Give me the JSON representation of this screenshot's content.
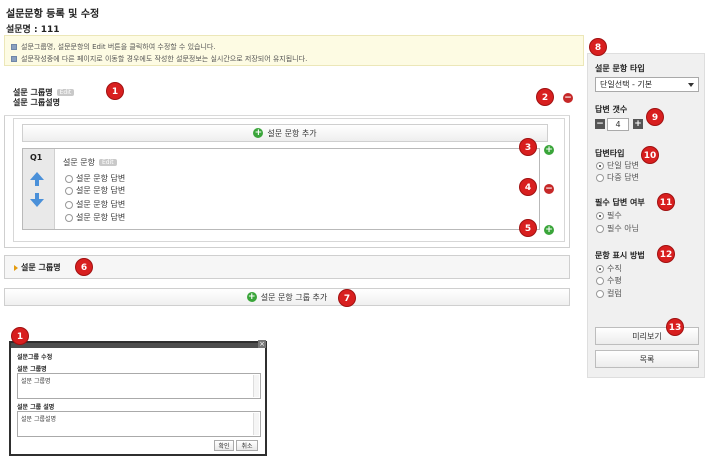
{
  "page": {
    "title": "설문문항 등록 및 수정",
    "survey_name_label": "설문명 : 111"
  },
  "notice": {
    "line1": "설문그룹명, 설문문항의 Edit 버튼을 클릭하여 수정할 수 있습니다.",
    "line2": "설문작성중에 다른 페이지로 이동할 경우에도 작성한 설문정보는 실시간으로 저장되어 유지됩니다."
  },
  "group1": {
    "name": "설문 그룹명",
    "edit_label": "Edit",
    "description": "설문 그룹설명",
    "add_question_label": "설문 문항 추가",
    "question": {
      "number": "Q1",
      "text": "설문 문항",
      "edit_label": "Edit",
      "answers": [
        "설문 문항 답변",
        "설문 문항 답변",
        "설문 문항 답변",
        "설문 문항 답변"
      ]
    }
  },
  "group2": {
    "name": "설문 그룹명"
  },
  "add_group_label": "설문 문항 그룹 추가",
  "callouts": [
    "1",
    "2",
    "3",
    "4",
    "5",
    "6",
    "7",
    "8",
    "9",
    "10",
    "11",
    "12",
    "13"
  ],
  "panel": {
    "question_type_label": "설문 문항 타입",
    "question_type_value": "단일선택 - 기본",
    "answer_count_label": "답변 갯수",
    "answer_count_value": "4",
    "answer_type_label": "답변타입",
    "answer_type_options": [
      "단일 답변",
      "다중 답변"
    ],
    "answer_type_selected": 0,
    "required_label": "필수 답변 여부",
    "required_options": [
      "필수",
      "필수 아님"
    ],
    "required_selected": 0,
    "layout_label": "문항 표시 방법",
    "layout_options": [
      "수직",
      "수평",
      "컬럼"
    ],
    "layout_selected": 0,
    "preview_label": "미리보기",
    "list_label": "목록"
  },
  "dialog": {
    "title": "설문그룹 수정",
    "name_label": "설문 그룹명",
    "name_value": "설문 그룹명",
    "desc_label": "설문 그룹 설명",
    "desc_value": "설문 그룹설명",
    "confirm_label": "확인",
    "cancel_label": "취소",
    "close_symbol": "×"
  },
  "colors": {
    "callout": "#d81f1f",
    "add_green": "#3aa53a",
    "remove_red": "#c62828",
    "arrow_blue": "#4a90d9",
    "notice_bg": "#fdfbe3"
  }
}
